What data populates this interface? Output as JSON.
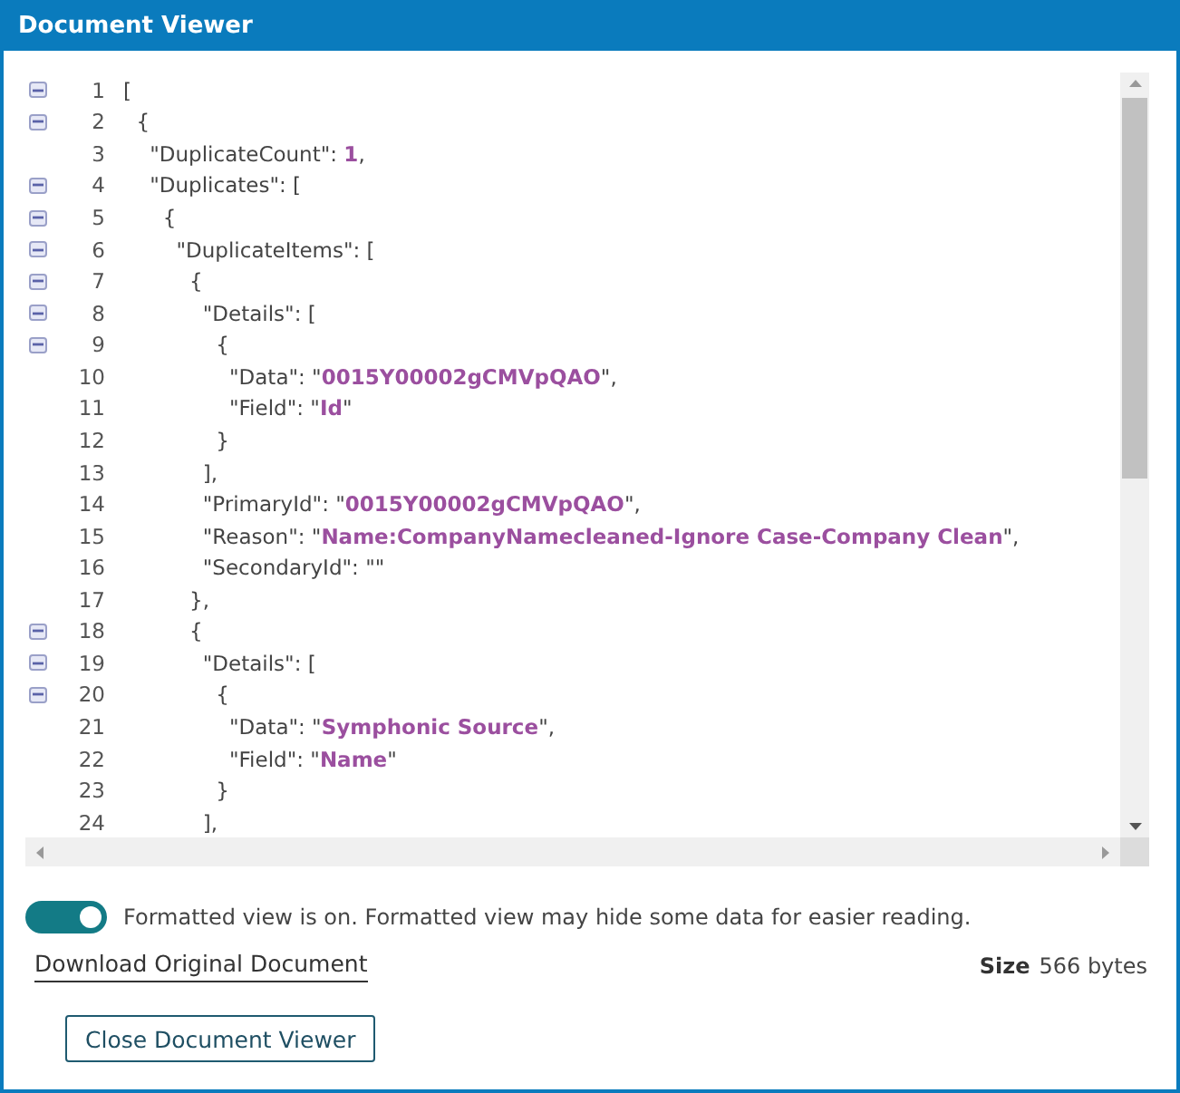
{
  "window": {
    "title": "Document Viewer"
  },
  "lines": [
    {
      "number": "1",
      "collapsible": true,
      "expanded": true,
      "text": "["
    },
    {
      "number": "2",
      "collapsible": true,
      "expanded": true,
      "text": "  {"
    },
    {
      "number": "3",
      "collapsible": false,
      "text": "    \"DuplicateCount\": **1**,"
    },
    {
      "number": "4",
      "collapsible": true,
      "expanded": true,
      "text": "    \"Duplicates\": ["
    },
    {
      "number": "5",
      "collapsible": true,
      "expanded": true,
      "text": "      {"
    },
    {
      "number": "6",
      "collapsible": true,
      "expanded": true,
      "text": "        \"DuplicateItems\": ["
    },
    {
      "number": "7",
      "collapsible": true,
      "expanded": true,
      "text": "          {"
    },
    {
      "number": "8",
      "collapsible": true,
      "expanded": true,
      "text": "            \"Details\": ["
    },
    {
      "number": "9",
      "collapsible": true,
      "expanded": true,
      "text": "              {"
    },
    {
      "number": "10",
      "collapsible": false,
      "text": "                \"Data\": \"**0015Y00002gCMVpQAO**\","
    },
    {
      "number": "11",
      "collapsible": false,
      "text": "                \"Field\": \"**Id**\""
    },
    {
      "number": "12",
      "collapsible": false,
      "text": "              }"
    },
    {
      "number": "13",
      "collapsible": false,
      "text": "            ],"
    },
    {
      "number": "14",
      "collapsible": false,
      "text": "            \"PrimaryId\": \"**0015Y00002gCMVpQAO**\","
    },
    {
      "number": "15",
      "collapsible": false,
      "text": "            \"Reason\": \"**Name:CompanyNamecleaned-Ignore Case-Company Clean**\","
    },
    {
      "number": "16",
      "collapsible": false,
      "text": "            \"SecondaryId\": \"\""
    },
    {
      "number": "17",
      "collapsible": false,
      "text": "          },"
    },
    {
      "number": "18",
      "collapsible": true,
      "expanded": true,
      "text": "          {"
    },
    {
      "number": "19",
      "collapsible": true,
      "expanded": true,
      "text": "            \"Details\": ["
    },
    {
      "number": "20",
      "collapsible": true,
      "expanded": true,
      "text": "              {"
    },
    {
      "number": "21",
      "collapsible": false,
      "text": "                \"Data\": \"**Symphonic Source**\","
    },
    {
      "number": "22",
      "collapsible": false,
      "text": "                \"Field\": \"**Name**\""
    },
    {
      "number": "23",
      "collapsible": false,
      "text": "              }"
    },
    {
      "number": "24",
      "collapsible": false,
      "text": "            ],"
    }
  ],
  "formatted_toggle": {
    "on": true,
    "label": "Formatted view is on. Formatted view may hide some data for easier reading."
  },
  "download_link": "Download Original Document",
  "size": {
    "label": "Size",
    "value": "566 bytes"
  },
  "close_button": "Close Document Viewer"
}
